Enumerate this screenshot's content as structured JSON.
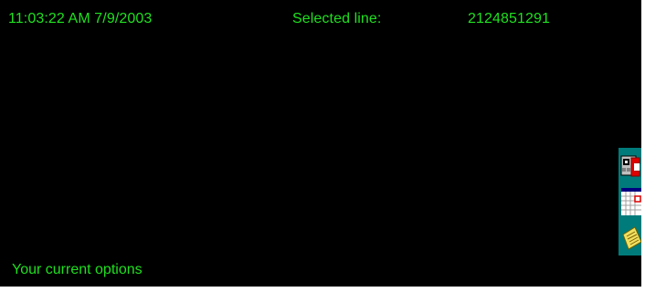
{
  "status": {
    "clock": "11:03:22 AM 7/9/2003",
    "selected_label": "Selected line:",
    "selected_value": "2124851291"
  },
  "footer": {
    "options_label": "Your current options"
  },
  "side_toolbar": {
    "buttons": [
      {
        "icon": "phone-icon"
      },
      {
        "icon": "calendar-icon"
      },
      {
        "icon": "notepad-icon"
      }
    ]
  },
  "colors": {
    "background": "#000000",
    "text": "#1fe01f",
    "toolbar": "#007b7b"
  }
}
